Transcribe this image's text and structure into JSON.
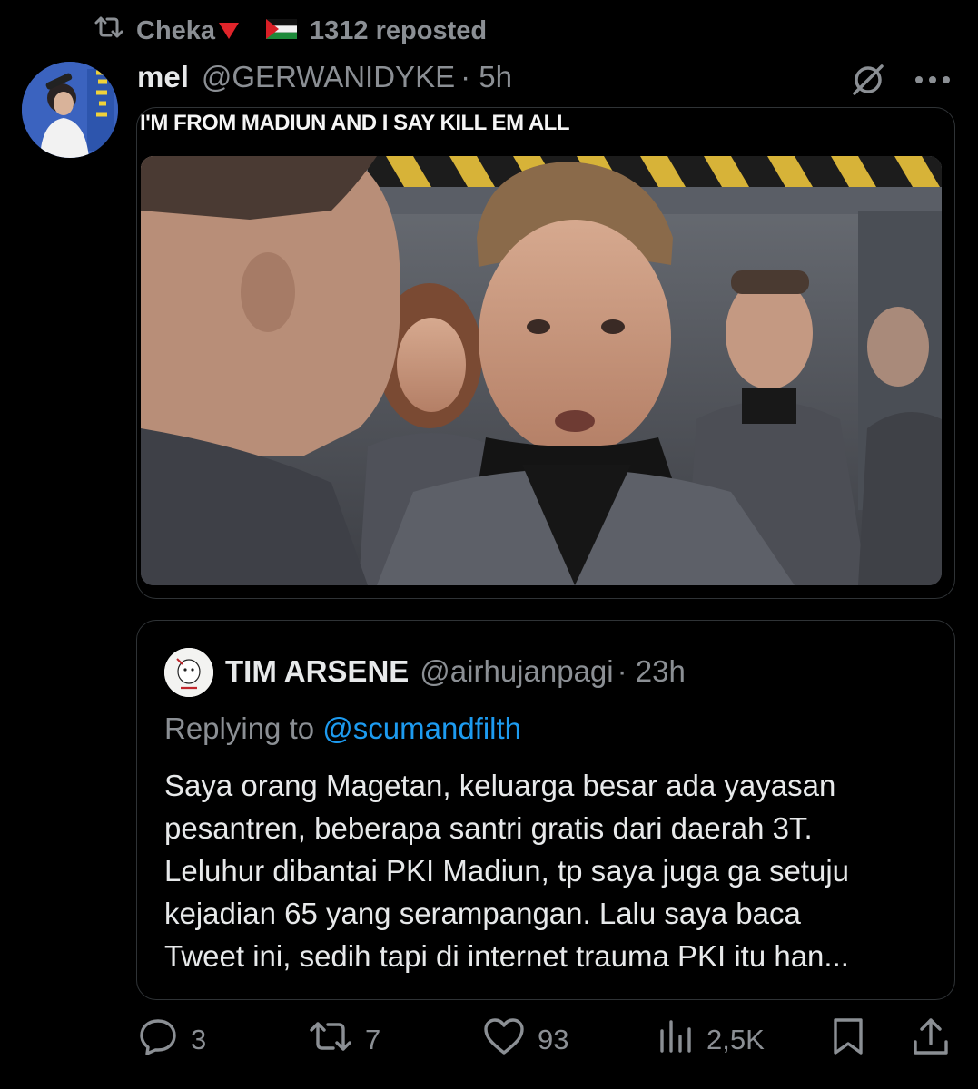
{
  "repost": {
    "icon": "repost-icon",
    "user": "Cheka",
    "user_emoji": "red-triangle-down",
    "flag": "palestine-flag",
    "count_text": "1312 reposted"
  },
  "post": {
    "display_name": "mel",
    "handle": "@GERWANIDYKE",
    "time": "· 5h",
    "video_caption": "I'M FROM MADIUN AND I SAY KILL EM ALL"
  },
  "quote": {
    "display_name": "TIM ARSENE",
    "handle": "@airhujanpagi",
    "time": "· 23h",
    "replying_prefix": "Replying to",
    "replying_mention": "@scumandfilth",
    "lines": [
      "Saya orang Magetan, keluarga besar ada yayasan",
      "pesantren, beberapa santri gratis dari daerah 3T.",
      "Leluhur dibantai PKI Madiun, tp saya juga ga setuju",
      "kejadian 65 yang serampangan. Lalu saya baca",
      "Tweet ini, sedih tapi di internet trauma PKI itu han..."
    ]
  },
  "actions": {
    "replies": "3",
    "reposts": "7",
    "likes": "93",
    "views": "2,5K"
  },
  "colors": {
    "background": "#000000",
    "text": "#e7e9ea",
    "muted": "#8b8f94",
    "link": "#1d9bf0",
    "border": "#2f3336"
  }
}
